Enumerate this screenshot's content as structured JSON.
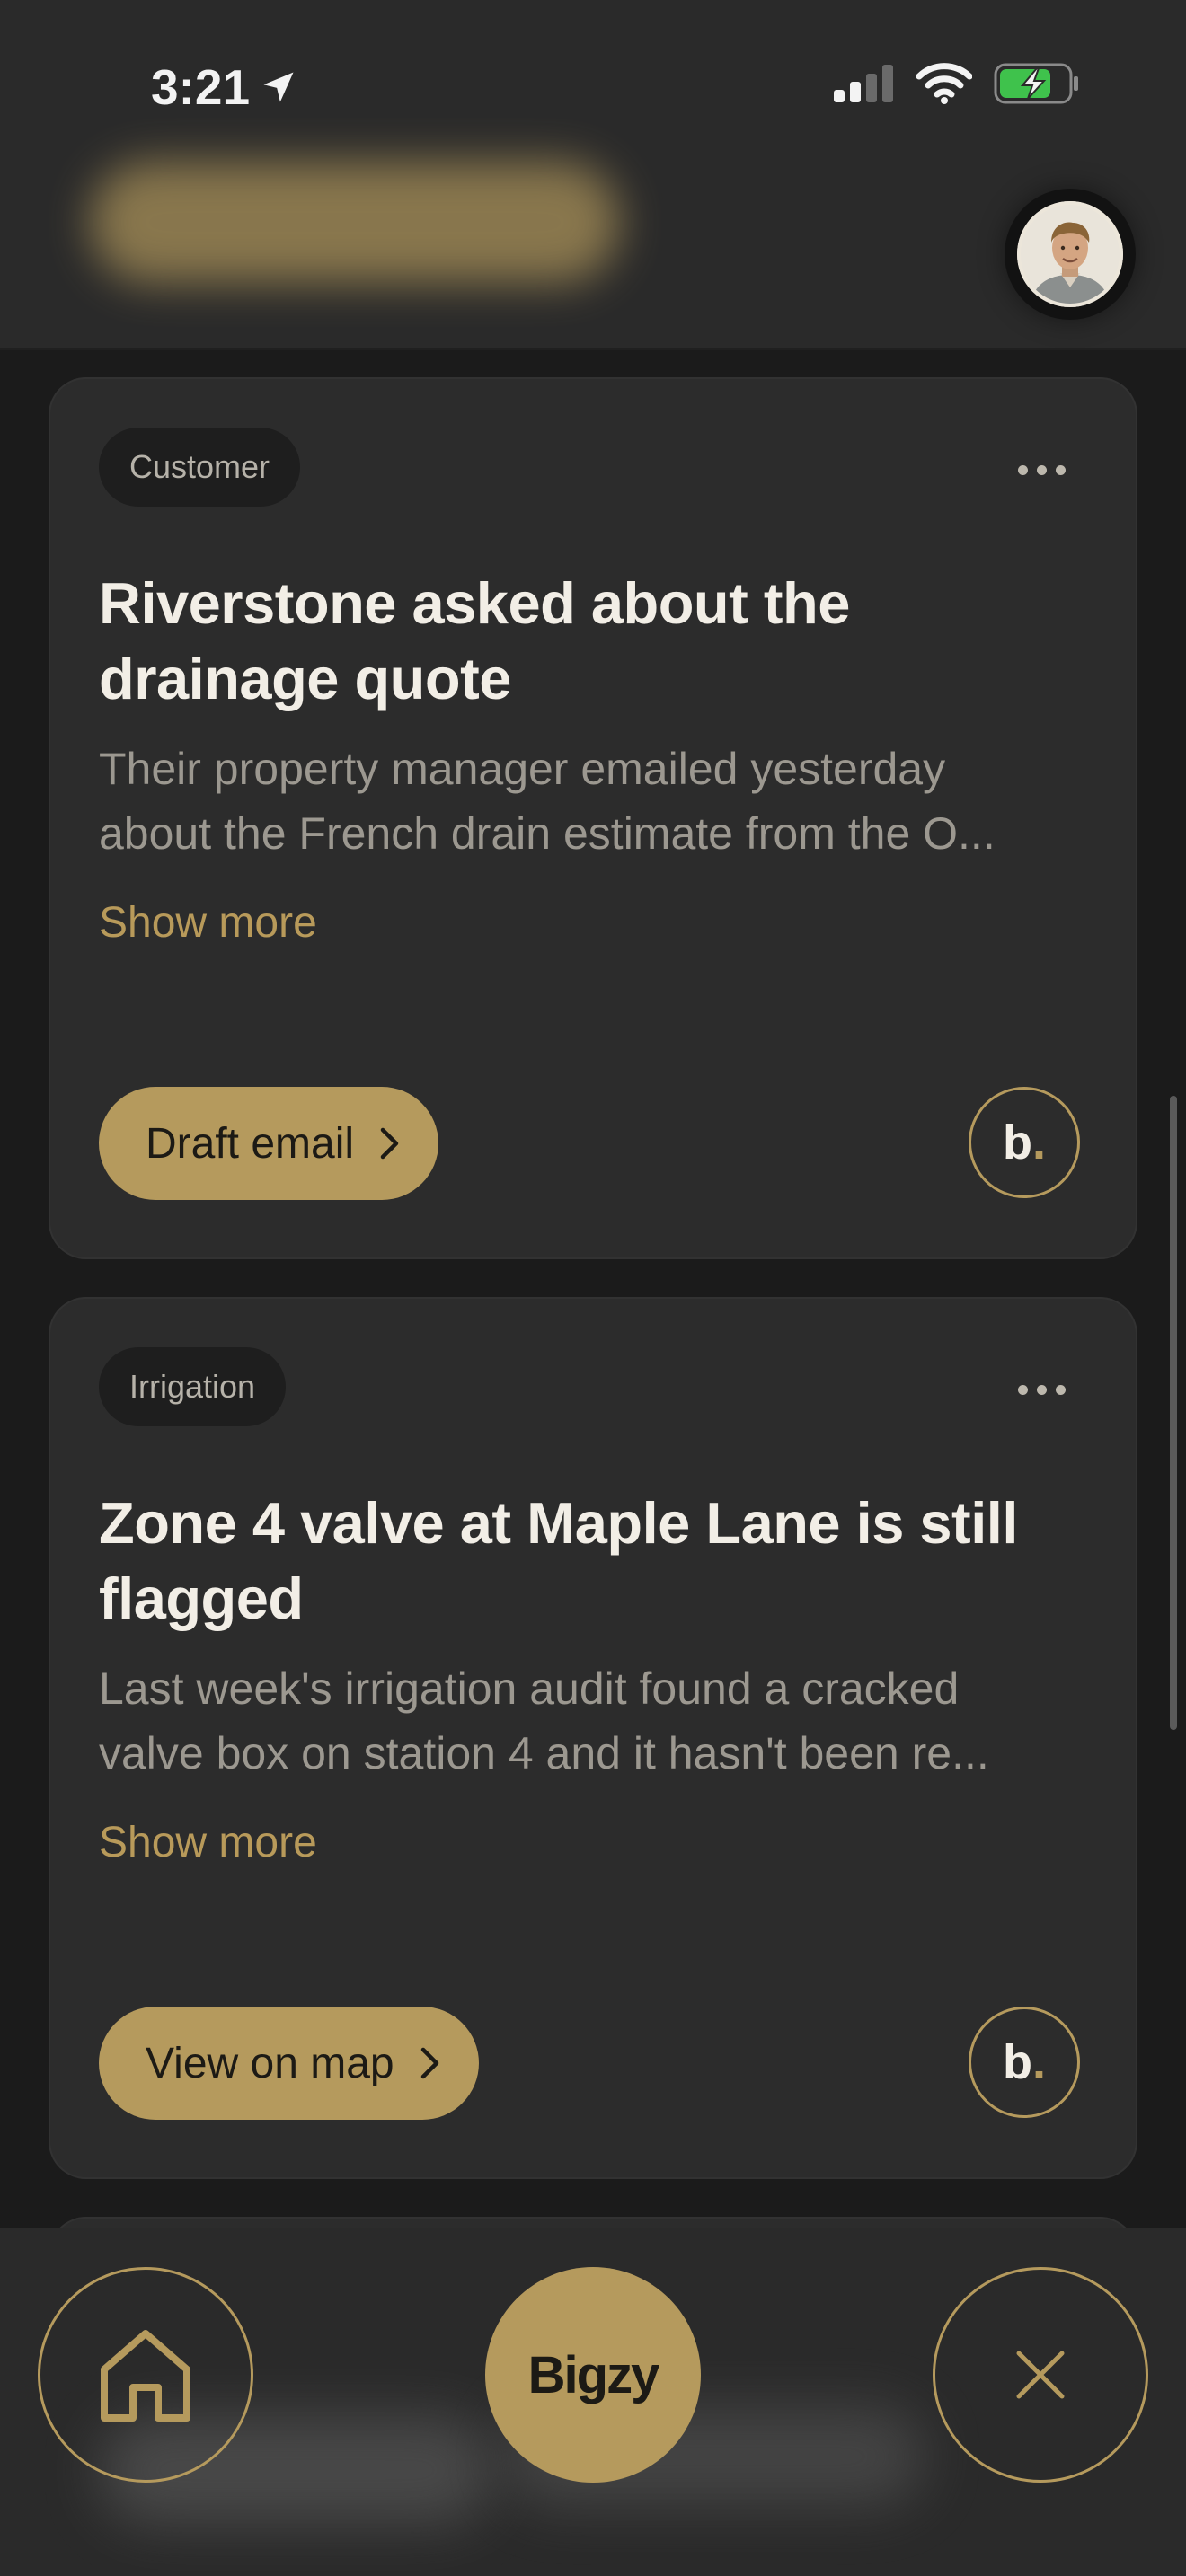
{
  "status_bar": {
    "time": "3:21",
    "location_icon": "location-arrow-icon",
    "signal_icon": "cellular-signal-icon",
    "wifi_icon": "wifi-icon",
    "battery_icon": "battery-charging-icon"
  },
  "header": {
    "avatar_icon": "user-avatar"
  },
  "cards": [
    {
      "chip": "Customer",
      "title": "Riverstone asked about the drainage quote",
      "body_lines": [
        "Their property manager emailed yesterday",
        "about the French drain estimate from the O..."
      ],
      "show_more": "Show more",
      "action_label": "Draft email",
      "badge_letter": "b",
      "badge_dot": "."
    },
    {
      "chip": "Irrigation",
      "title": "Zone 4 valve at Maple Lane is still flagged",
      "body_lines": [
        "Last week's irrigation audit found a cracked",
        "valve box on station 4 and it hasn't been re..."
      ],
      "show_more": "Show more",
      "action_label": "View on map",
      "badge_letter": "b",
      "badge_dot": "."
    }
  ],
  "bottom_nav": {
    "home_icon": "home-icon",
    "center_label": "Bigzy",
    "close_icon": "close-icon"
  },
  "colors": {
    "accent": "#b59a5d",
    "card_bg": "#2c2c2c",
    "page_bg": "#1b1b1b"
  }
}
